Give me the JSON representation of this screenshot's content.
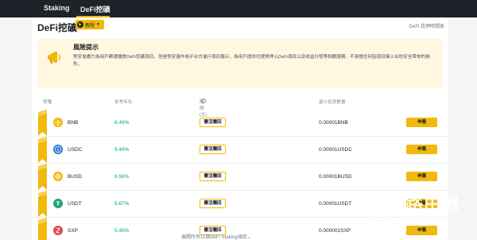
{
  "nav": {
    "staking": "Staking",
    "defi": "DeFi挖礦"
  },
  "page": {
    "title": "DeFi挖礦",
    "tutorial": "教程",
    "agreement": "DeFi 質押時間表"
  },
  "risk": {
    "title": "風險提示",
    "text": "幣安會盡力為用戶篩選優質DeFi挖礦項目，但是幣安僅作為平台方進行項目展示，為用戶提供代理質押入DeFi項目以及收益分發等相關服務，不承擔任何因項目鏈上合約安全帶來的損失。"
  },
  "table": {
    "headers": {
      "coin": "幣種",
      "apy": "參考年化",
      "duration": "期限 (天)",
      "info": "i",
      "min": "最小投資數量"
    },
    "rows": [
      {
        "coin": "BNB",
        "apy": "8.49%",
        "action": "靈活贖回",
        "min": "0.00001BNB",
        "subscribe": "申購",
        "icon": "bnb-coin-icon",
        "color": "#f0b90b"
      },
      {
        "coin": "USDC",
        "apy": "9.49%",
        "action": "靈活贖回",
        "min": "0.00001USDC",
        "subscribe": "申購",
        "icon": "usdc-coin-icon",
        "color": "#2775ca"
      },
      {
        "coin": "BUSD",
        "apy": "6.56%",
        "action": "靈活贖回",
        "min": "0.00001BUSD",
        "subscribe": "申購",
        "icon": "busd-coin-icon",
        "color": "#f0b90b"
      },
      {
        "coin": "USDT",
        "apy": "5.67%",
        "action": "靈活贖回",
        "min": "0.00001USDT",
        "subscribe": "申購",
        "icon": "usdt-coin-icon",
        "color": "#26a17b"
      },
      {
        "coin": "SXP",
        "apy": "5.45%",
        "action": "靈活贖回",
        "min": "0.000001SXP",
        "subscribe": "申購",
        "icon": "sxp-coin-icon",
        "color": "#e34a4a"
      }
    ]
  },
  "footer": {
    "more": "展開所有11個DeFi Staking項目⌄"
  },
  "watermark": {
    "text": "路由器",
    "sub": "luyouqi.com"
  }
}
